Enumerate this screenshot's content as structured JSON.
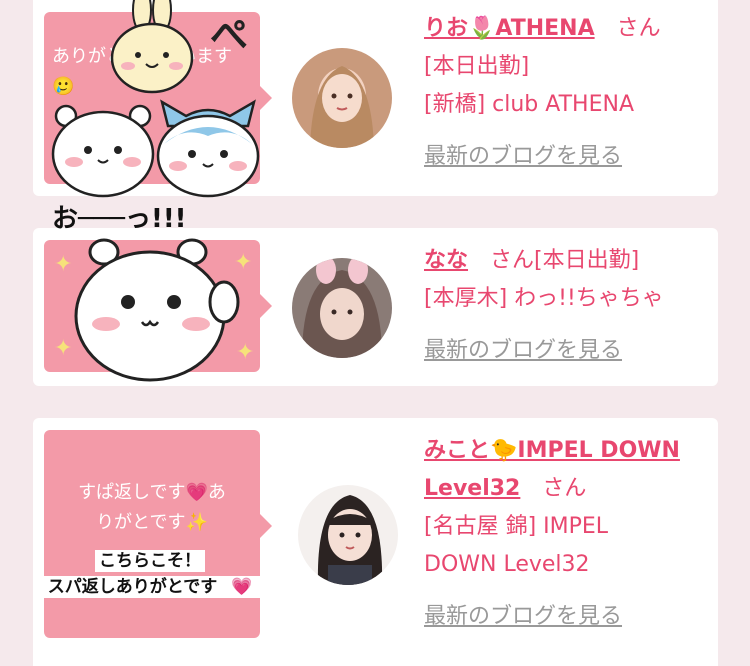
{
  "cards": [
    {
      "name": "りお🌷ATHENA",
      "san": "さん",
      "status": "[本日出勤]",
      "shop": "[新橋] club ATHENA",
      "blog_link": "最新のブログを見る",
      "bubble_text": "ありがとうございます🥲"
    },
    {
      "name": "なな",
      "san": "さん[本日出勤]",
      "shop": "[本厚木] わっ!!ちゃちゃ",
      "blog_link": "最新のブログを見る",
      "sticker_text": "お───っ!!!"
    },
    {
      "name_line1": "みこと🐤IMPEL DOWN",
      "name_line2": "Level32",
      "san": "さん",
      "shop_line1": "[名古屋 錦] IMPEL",
      "shop_line2": "DOWN Level32",
      "blog_link": "最新のブログを見る",
      "bubble_line1": "すぱ返しです💗あ",
      "bubble_line2": "りがとです✨",
      "caption_line1": "こちらこそ！",
      "caption_line2": "スパ返しありがとです"
    }
  ],
  "colors": {
    "accent": "#e8476f",
    "bubble": "#f39aa8",
    "link_gray": "#999999",
    "background": "#f5e9ec"
  },
  "icons": [
    "chiikawa-sticker",
    "hachiware-sticker",
    "usagi-sticker",
    "heart-icon",
    "avatar-photo"
  ]
}
